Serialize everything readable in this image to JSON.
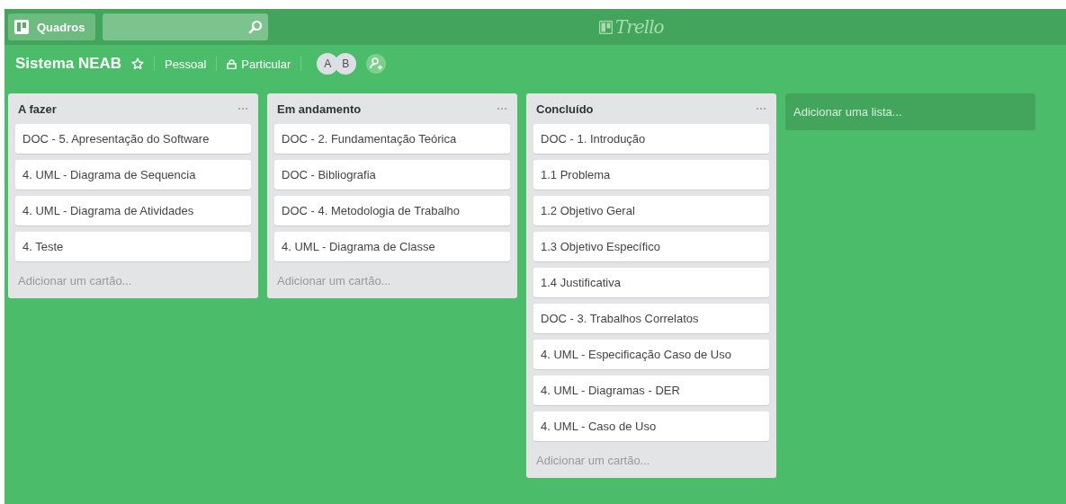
{
  "top_bar": {
    "boards_button": "Quadros",
    "logo": "Trello"
  },
  "board_header": {
    "title": "Sistema NEAB",
    "starred": false,
    "team": "Pessoal",
    "visibility": "Particular",
    "members": [
      "A",
      "B"
    ]
  },
  "lists": [
    {
      "title": "A fazer",
      "cards": [
        "DOC - 5. Apresentação do Software",
        "4. UML - Diagrama de Sequencia",
        "4. UML - Diagrama de Atividades",
        "4. Teste"
      ],
      "add_card": "Adicionar um cartão..."
    },
    {
      "title": "Em andamento",
      "cards": [
        "DOC - 2. Fundamentação Teórica",
        "DOC - Bibliografia",
        "DOC - 4. Metodologia de Trabalho",
        "4. UML - Diagrama de Classe"
      ],
      "add_card": "Adicionar um cartão..."
    },
    {
      "title": "Concluído",
      "cards": [
        "DOC - 1. Introdução",
        "1.1 Problema",
        "1.2 Objetivo Geral",
        "1.3 Objetivo Específico",
        "1.4 Justificativa",
        "DOC - 3. Trabalhos Correlatos",
        "4. UML - Especificação Caso de Uso",
        "4. UML - Diagramas - DER",
        "4. UML - Caso de Uso"
      ],
      "add_card": "Adicionar um cartão..."
    }
  ],
  "add_list": "Adicionar uma lista..."
}
